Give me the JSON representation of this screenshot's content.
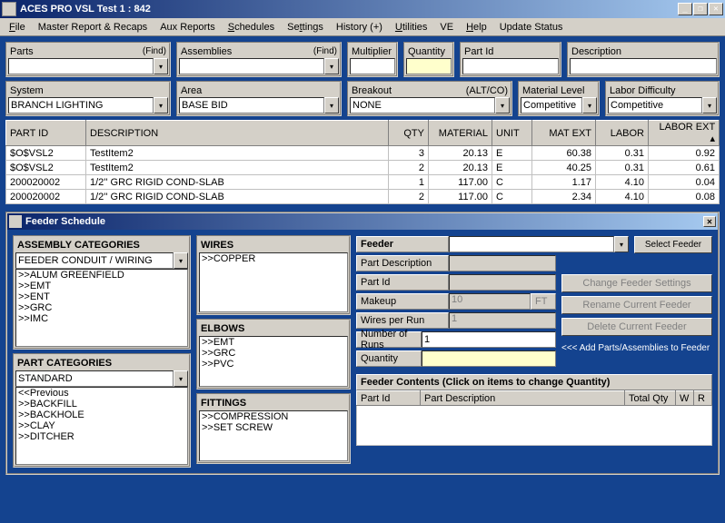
{
  "window": {
    "title": "ACES PRO  VSL Test 1 : 842"
  },
  "menu": [
    "File",
    "Master Report & Recaps",
    "Aux Reports",
    "Schedules",
    "Settings",
    "History (+)",
    "Utilities",
    "VE",
    "Help",
    "Update Status"
  ],
  "topfields": {
    "parts": {
      "label": "Parts",
      "find": "(Find)"
    },
    "assemblies": {
      "label": "Assemblies",
      "find": "(Find)"
    },
    "multiplier": {
      "label": "Multiplier"
    },
    "quantity": {
      "label": "Quantity"
    },
    "partid": {
      "label": "Part Id"
    },
    "description": {
      "label": "Description"
    }
  },
  "selectors": {
    "system": {
      "label": "System",
      "value": "BRANCH LIGHTING"
    },
    "area": {
      "label": "Area",
      "value": "BASE BID"
    },
    "breakout": {
      "label": "Breakout",
      "alt": "(ALT/CO)",
      "value": "NONE"
    },
    "matlevel": {
      "label": "Material Level",
      "value": "Competitive"
    },
    "labor": {
      "label": "Labor Difficulty",
      "value": "Competitive"
    }
  },
  "grid": {
    "headers": [
      "PART ID",
      "DESCRIPTION",
      "QTY",
      "MATERIAL",
      "UNIT",
      "MAT EXT",
      "LABOR",
      "LABOR EXT"
    ],
    "rows": [
      [
        "$O$VSL2",
        "TestItem2",
        "3",
        "20.13",
        "E",
        "60.38",
        "0.31",
        "0.92"
      ],
      [
        "$O$VSL2",
        "TestItem2",
        "2",
        "20.13",
        "E",
        "40.25",
        "0.31",
        "0.61"
      ],
      [
        "200020002",
        "1/2'' GRC RIGID COND-SLAB",
        "1",
        "117.00",
        "C",
        "1.17",
        "4.10",
        "0.04"
      ],
      [
        "200020002",
        "1/2'' GRC RIGID COND-SLAB",
        "2",
        "117.00",
        "C",
        "2.34",
        "4.10",
        "0.08"
      ]
    ]
  },
  "feeder": {
    "title": "Feeder Schedule",
    "asm_cat": {
      "label": "ASSEMBLY CATEGORIES",
      "value": "FEEDER CONDUIT / WIRING",
      "items": [
        ">>ALUM GREENFIELD",
        ">>EMT",
        ">>ENT",
        ">>GRC",
        ">>IMC"
      ]
    },
    "part_cat": {
      "label": "PART CATEGORIES",
      "value": "STANDARD",
      "items": [
        "<<Previous",
        ">>BACKFILL",
        ">>BACKHOLE",
        ">>CLAY",
        ">>DITCHER"
      ]
    },
    "wires": {
      "label": "WIRES",
      "items": [
        ">>COPPER"
      ]
    },
    "elbows": {
      "label": "ELBOWS",
      "items": [
        ">>EMT",
        ">>GRC",
        ">>PVC"
      ]
    },
    "fittings": {
      "label": "FITTINGS",
      "items": [
        ">>COMPRESSION",
        ">>SET SCREW"
      ]
    },
    "form": {
      "feeder_lbl": "Feeder",
      "select_btn": "Select Feeder",
      "partdesc_lbl": "Part Description",
      "partid_lbl": "Part Id",
      "makeup_lbl": "Makeup",
      "makeup_val": "10",
      "makeup_unit": "FT",
      "wpr_lbl": "Wires per Run",
      "wpr_val": "1",
      "nor_lbl": "Number of Runs",
      "nor_val": "1",
      "qty_lbl": "Quantity",
      "add_hint": "<<< Add Parts/Assemblies to Feeder",
      "btn_change": "Change Feeder Settings",
      "btn_rename": "Rename Current Feeder",
      "btn_delete": "Delete Current Feeder"
    },
    "contents": {
      "header": "Feeder Contents  (Click on items to change Quantity)",
      "cols": [
        "Part Id",
        "Part Description",
        "Total Qty",
        "W",
        "R"
      ]
    }
  }
}
